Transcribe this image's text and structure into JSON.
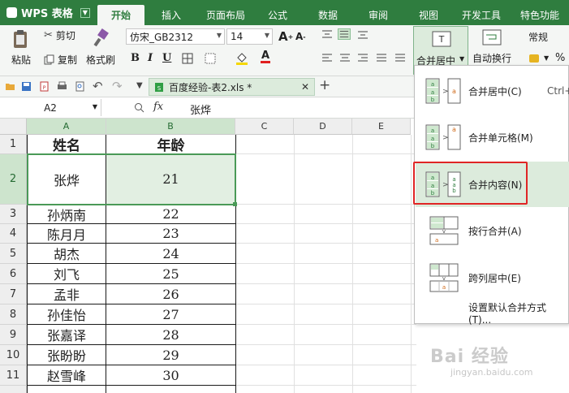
{
  "app": {
    "title": "WPS 表格"
  },
  "tabs": [
    "开始",
    "插入",
    "页面布局",
    "公式",
    "数据",
    "审阅",
    "视图",
    "开发工具",
    "特色功能"
  ],
  "ribbon": {
    "paste": "粘贴",
    "cut": "剪切",
    "copy": "复制",
    "format_painter": "格式刷",
    "font_name": "仿宋_GB2312",
    "font_size": "14",
    "merge_center": "合并居中",
    "wrap_text": "自动换行",
    "number_format": "常规",
    "percent": "%"
  },
  "document": {
    "tab_title": "百度经验-表2.xls *"
  },
  "formula_bar": {
    "name_box": "A2",
    "fx": "fx",
    "content": "张烨"
  },
  "columns": [
    "A",
    "B",
    "C",
    "D",
    "E"
  ],
  "rows": [
    {
      "num": "1",
      "name": "姓名",
      "age": "年龄"
    },
    {
      "num": "2",
      "name": "张烨",
      "age": "21"
    },
    {
      "num": "3",
      "name": "孙炳南",
      "age": "22"
    },
    {
      "num": "4",
      "name": "陈月月",
      "age": "23"
    },
    {
      "num": "5",
      "name": "胡杰",
      "age": "24"
    },
    {
      "num": "6",
      "name": "刘飞",
      "age": "25"
    },
    {
      "num": "7",
      "name": "孟非",
      "age": "26"
    },
    {
      "num": "8",
      "name": "孙佳怡",
      "age": "27"
    },
    {
      "num": "9",
      "name": "张嘉译",
      "age": "28"
    },
    {
      "num": "10",
      "name": "张盼盼",
      "age": "29"
    },
    {
      "num": "11",
      "name": "赵雪峰",
      "age": "30"
    }
  ],
  "merge_menu": {
    "items": [
      {
        "label": "合并居中(C)",
        "shortcut": "Ctrl+"
      },
      {
        "label": "合并单元格(M)",
        "shortcut": ""
      },
      {
        "label": "合并内容(N)",
        "shortcut": ""
      },
      {
        "label": "按行合并(A)",
        "shortcut": ""
      },
      {
        "label": "跨列居中(E)",
        "shortcut": ""
      }
    ],
    "default_option": "设置默认合并方式(T)..."
  },
  "watermark": "Bai 经验",
  "watermark_sub": "jingyan.baidu.com",
  "colors": {
    "accent": "#2f7d3f",
    "selection": "#dcebdc",
    "highlight_border": "#e02525"
  }
}
